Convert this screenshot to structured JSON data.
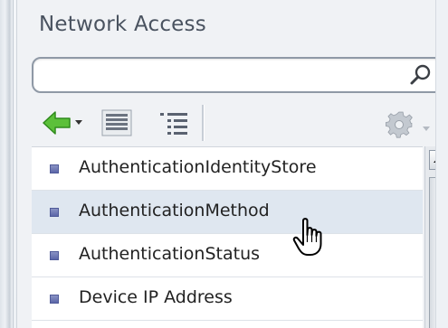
{
  "panel": {
    "title": "Network Access"
  },
  "search": {
    "value": "",
    "placeholder": "",
    "icon": "search-icon"
  },
  "toolbar": {
    "back_icon": "back-arrow-dropdown-icon",
    "list_view_icon": "list-view-icon",
    "tree_view_icon": "tree-view-icon",
    "settings_icon": "gear-dropdown-icon"
  },
  "attributes": {
    "items": [
      {
        "label": "AuthenticationIdentityStore",
        "selected": false
      },
      {
        "label": "AuthenticationMethod",
        "selected": true
      },
      {
        "label": "AuthenticationStatus",
        "selected": false
      },
      {
        "label": "Device IP Address",
        "selected": false
      }
    ]
  },
  "colors": {
    "accent_green": "#4cb82e",
    "selection_bg": "#dfe7f0",
    "bullet": "#5b66a8",
    "title_text": "#4a5360"
  }
}
